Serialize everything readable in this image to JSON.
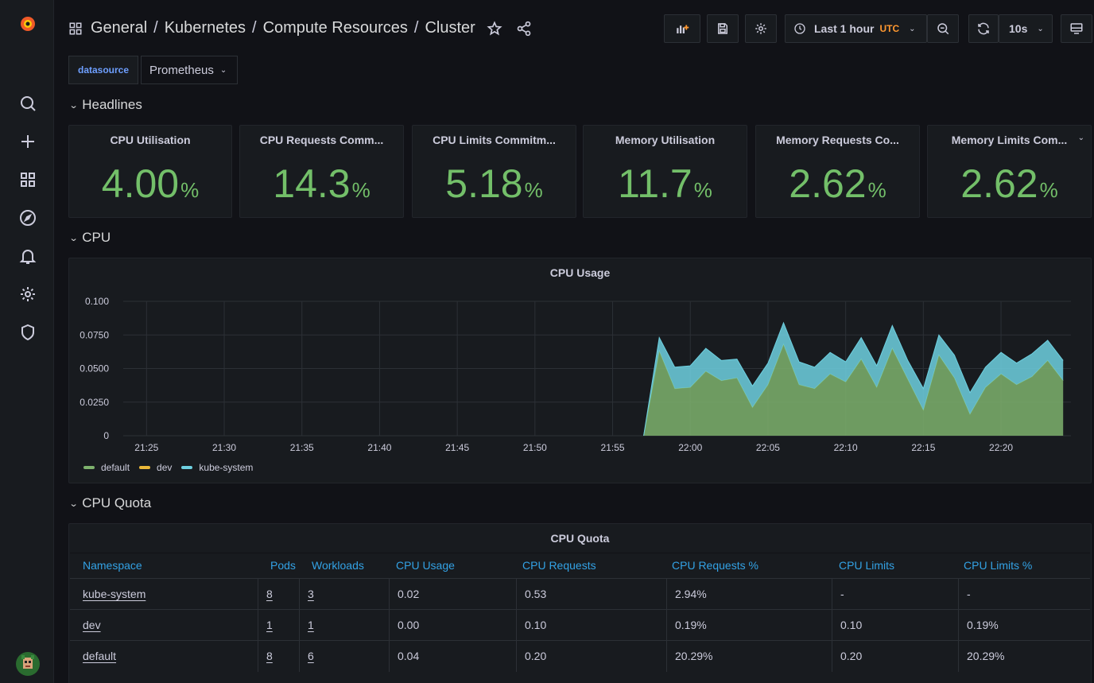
{
  "breadcrumb": {
    "folder": "General",
    "path": [
      "Kubernetes",
      "Compute Resources",
      "Cluster"
    ],
    "separator": "/"
  },
  "toolbar": {
    "time_range": "Last 1 hour",
    "timezone": "UTC",
    "refresh": "10s"
  },
  "variable": {
    "label": "datasource",
    "value": "Prometheus"
  },
  "rows": {
    "headlines": "Headlines",
    "cpu": "CPU",
    "cpu_quota": "CPU Quota"
  },
  "stats": [
    {
      "title": "CPU Utilisation",
      "value": "4.00",
      "unit": "%"
    },
    {
      "title": "CPU Requests Comm...",
      "value": "14.3",
      "unit": "%"
    },
    {
      "title": "CPU Limits Commitm...",
      "value": "5.18",
      "unit": "%"
    },
    {
      "title": "Memory Utilisation",
      "value": "11.7",
      "unit": "%"
    },
    {
      "title": "Memory Requests Co...",
      "value": "2.62",
      "unit": "%"
    },
    {
      "title": "Memory Limits Com...",
      "value": "2.62",
      "unit": "%"
    }
  ],
  "cpu_panel": {
    "title": "CPU Usage"
  },
  "chart_data": {
    "type": "area",
    "title": "CPU Usage",
    "x_ticks": [
      "21:25",
      "21:30",
      "21:35",
      "21:40",
      "21:45",
      "21:50",
      "21:55",
      "22:00",
      "22:05",
      "22:10",
      "22:15",
      "22:20"
    ],
    "y_ticks": [
      "0",
      "0.0250",
      "0.0500",
      "0.0750",
      "0.100"
    ],
    "ylim": [
      0,
      0.1
    ],
    "stacked": true,
    "x": [
      "21:57",
      "21:58",
      "21:59",
      "22:00",
      "22:01",
      "22:02",
      "22:03",
      "22:04",
      "22:05",
      "22:06",
      "22:07",
      "22:08",
      "22:09",
      "22:10",
      "22:11",
      "22:12",
      "22:13",
      "22:14",
      "22:15",
      "22:16",
      "22:17",
      "22:18",
      "22:19",
      "22:20",
      "22:21",
      "22:22",
      "22:23",
      "22:24"
    ],
    "series": [
      {
        "name": "default",
        "color": "#7eb26d",
        "values": [
          0,
          0.063,
          0.035,
          0.036,
          0.048,
          0.041,
          0.043,
          0.021,
          0.038,
          0.068,
          0.038,
          0.035,
          0.046,
          0.04,
          0.057,
          0.036,
          0.065,
          0.042,
          0.019,
          0.06,
          0.043,
          0.016,
          0.036,
          0.046,
          0.038,
          0.044,
          0.056,
          0.041
        ]
      },
      {
        "name": "dev",
        "color": "#eab839",
        "values": [
          0,
          0,
          0,
          0,
          0,
          0,
          0,
          0,
          0,
          0,
          0,
          0,
          0,
          0,
          0,
          0,
          0,
          0,
          0,
          0,
          0,
          0,
          0,
          0,
          0,
          0,
          0,
          0
        ]
      },
      {
        "name": "kube-system",
        "color": "#6ed0e0",
        "values": [
          0,
          0.01,
          0.016,
          0.016,
          0.017,
          0.015,
          0.014,
          0.016,
          0.016,
          0.016,
          0.017,
          0.016,
          0.016,
          0.015,
          0.016,
          0.016,
          0.017,
          0.014,
          0.016,
          0.015,
          0.017,
          0.016,
          0.015,
          0.016,
          0.016,
          0.017,
          0.015,
          0.015
        ]
      }
    ],
    "legend": "bottom-left",
    "grid": true
  },
  "quota": {
    "title": "CPU Quota",
    "columns": [
      "Namespace",
      "Pods",
      "Workloads",
      "CPU Usage",
      "CPU Requests",
      "CPU Requests %",
      "CPU Limits",
      "CPU Limits %"
    ],
    "rows": [
      [
        "kube-system",
        "8",
        "3",
        "0.02",
        "0.53",
        "2.94%",
        "-",
        "-"
      ],
      [
        "dev",
        "1",
        "1",
        "0.00",
        "0.10",
        "0.19%",
        "0.10",
        "0.19%"
      ],
      [
        "default",
        "8",
        "6",
        "0.04",
        "0.20",
        "20.29%",
        "0.20",
        "20.29%"
      ]
    ]
  }
}
